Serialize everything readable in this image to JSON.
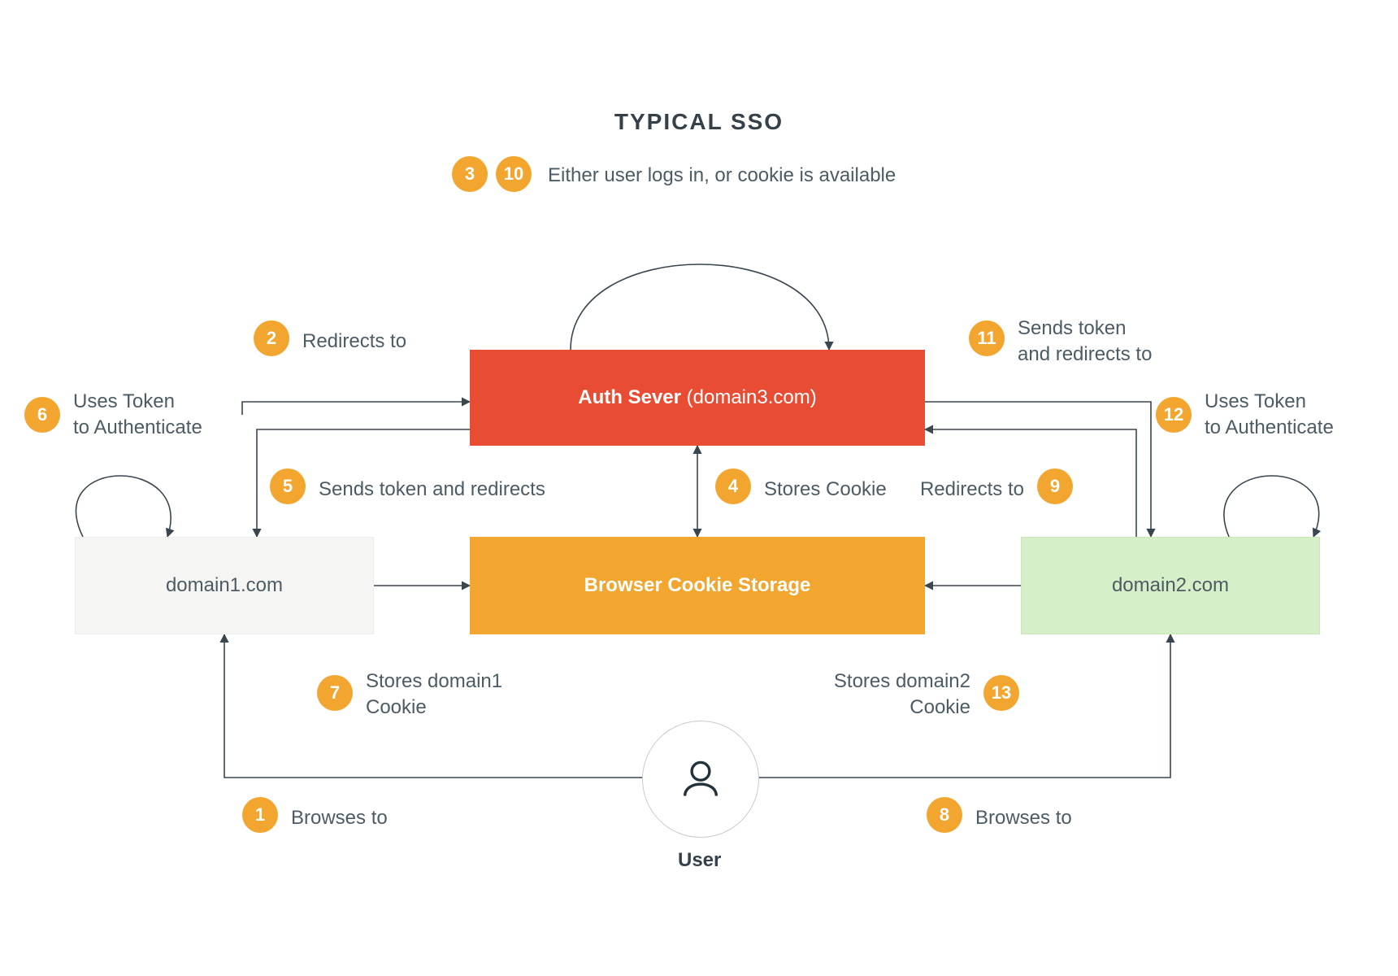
{
  "title": "TYPICAL SSO",
  "nodes": {
    "auth": {
      "label_strong": "Auth Sever",
      "label_sub": " (domain3.com)"
    },
    "storage": {
      "label": "Browser Cookie Storage"
    },
    "d1": {
      "label": "domain1.com"
    },
    "d2": {
      "label": "domain2.com"
    },
    "user": {
      "label": "User"
    }
  },
  "steps": {
    "1": {
      "text": "Browses to"
    },
    "2": {
      "text": "Redirects to"
    },
    "3": {
      "shared_text": "Either user logs in, or cookie is available"
    },
    "4": {
      "text": "Stores Cookie"
    },
    "5": {
      "text": "Sends token and redirects"
    },
    "6": {
      "text": "Uses Token\nto Authenticate"
    },
    "7": {
      "text": "Stores domain1\nCookie"
    },
    "8": {
      "text": "Browses to"
    },
    "9": {
      "text": "Redirects to"
    },
    "10": {
      "shared_with": "3"
    },
    "11": {
      "text": "Sends token\nand redirects to"
    },
    "12": {
      "text": "Uses Token\nto Authenticate"
    },
    "13": {
      "text": "Stores domain2\nCookie"
    }
  },
  "colors": {
    "badge": "#f2a62f",
    "auth": "#e84d33",
    "stor": "#f2a62f",
    "d1": "#f5f5f4",
    "d2": "#d6efc8",
    "text": "#4d5b64",
    "edge": "#3a464f"
  }
}
